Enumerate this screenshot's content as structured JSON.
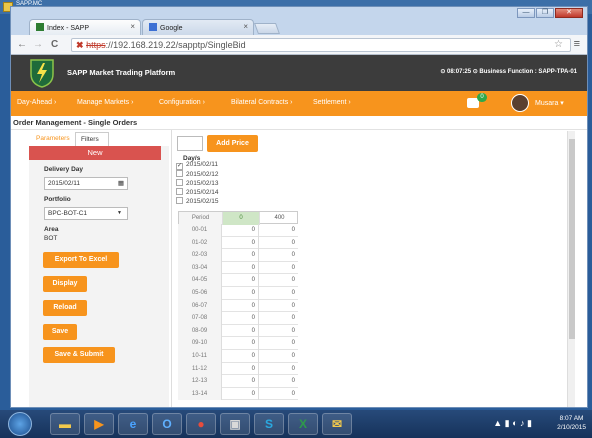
{
  "desktop": {
    "corner_label": "SAPP.MC"
  },
  "browser": {
    "tabs": [
      {
        "label": "Index - SAPP",
        "close": "×"
      },
      {
        "label": "Google",
        "close": "×"
      }
    ],
    "url_lock": "✖",
    "url_scheme": "https",
    "url_rest": "://192.168.219.22/sapptp/SingleBid",
    "window_buttons": [
      "—",
      "❐",
      "✕"
    ]
  },
  "app": {
    "title": "SAPP Market Trading Platform",
    "header_right": "⊙ 08:07:25  ⊙ Business Function : SAPP-TPA-01",
    "nav": [
      "Day-Ahead ›",
      "Manage Markets ›",
      "Configuration ›",
      "Bilateral Contracts ›",
      "Settlement ›"
    ],
    "notification_count": "0",
    "user": "Musara ▾",
    "page_title": "Order Management - Single Orders",
    "left_tabs": {
      "parameters": "Parameters",
      "filters": "Filters"
    },
    "new_label": "New",
    "delivery_day_label": "Delivery Day",
    "delivery_day_value": "2015/02/11",
    "portfolio_label": "Portfolio",
    "portfolio_value": "BPC-BOT-C1",
    "area_label": "Area",
    "area_value": "BOT",
    "buttons": {
      "export": "Export To Excel",
      "display": "Display",
      "reload": "Reload",
      "save": "Save",
      "save_submit": "Save & Submit"
    },
    "add_price": "Add Price",
    "days_label": "Day/s",
    "days": [
      {
        "date": "2015/02/11",
        "checked": true
      },
      {
        "date": "2015/02/12",
        "checked": false
      },
      {
        "date": "2015/02/13",
        "checked": false
      },
      {
        "date": "2015/02/14",
        "checked": false
      },
      {
        "date": "2015/02/15",
        "checked": false
      }
    ],
    "grid": {
      "headers": [
        "Period",
        "0",
        "400"
      ],
      "rows": [
        [
          "00-01",
          "0",
          "0"
        ],
        [
          "01-02",
          "0",
          "0"
        ],
        [
          "02-03",
          "0",
          "0"
        ],
        [
          "03-04",
          "0",
          "0"
        ],
        [
          "04-05",
          "0",
          "0"
        ],
        [
          "05-06",
          "0",
          "0"
        ],
        [
          "06-07",
          "0",
          "0"
        ],
        [
          "07-08",
          "0",
          "0"
        ],
        [
          "08-09",
          "0",
          "0"
        ],
        [
          "09-10",
          "0",
          "0"
        ],
        [
          "10-11",
          "0",
          "0"
        ],
        [
          "11-12",
          "0",
          "0"
        ],
        [
          "12-13",
          "0",
          "0"
        ],
        [
          "13-14",
          "0",
          "0"
        ]
      ]
    }
  },
  "taskbar": {
    "time": "8:07 AM",
    "date": "2/10/2015"
  },
  "colors": {
    "accent": "#f7941d",
    "header": "#3c3c3c",
    "new_bar": "#d9534f"
  }
}
